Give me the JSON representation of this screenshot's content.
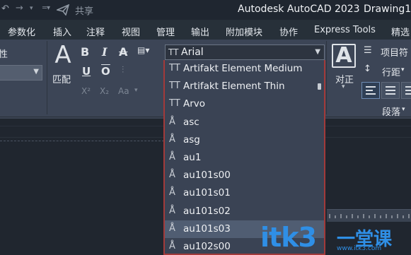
{
  "titlebar": {
    "share_label": "共享",
    "app_title": "Autodesk AutoCAD 2023",
    "doc_title": "Drawing1."
  },
  "menu": {
    "items": [
      "参数化",
      "插入",
      "注释",
      "视图",
      "管理",
      "输出",
      "附加模块",
      "协作",
      "Express Tools",
      "精选"
    ]
  },
  "ribbon": {
    "properties_label": "性",
    "match_label": "匹配",
    "align_label": "对正",
    "list_label": "项目符",
    "spacing_label": "行距",
    "paragraph_label": "段落",
    "tools": {
      "bold": "B",
      "italic": "I",
      "strike": "A",
      "underline": "U",
      "overline": "O",
      "superscript": "X²",
      "subscript": "X₂",
      "case": "Aa"
    }
  },
  "font_combo": {
    "value": "Arial"
  },
  "font_list": [
    {
      "name": "Artifakt Element Medium",
      "type": "truetype",
      "selected": false
    },
    {
      "name": "Artifakt Element Thin",
      "type": "truetype",
      "selected": false
    },
    {
      "name": "Arvo",
      "type": "truetype",
      "selected": false
    },
    {
      "name": "asc",
      "type": "shx",
      "selected": false
    },
    {
      "name": "asg",
      "type": "shx",
      "selected": false
    },
    {
      "name": "au1",
      "type": "shx",
      "selected": false
    },
    {
      "name": "au101s00",
      "type": "shx",
      "selected": false
    },
    {
      "name": "au101s01",
      "type": "shx",
      "selected": false
    },
    {
      "name": "au101s02",
      "type": "shx",
      "selected": false
    },
    {
      "name": "au101s03",
      "type": "shx",
      "selected": true
    },
    {
      "name": "au102s00",
      "type": "shx",
      "selected": false
    }
  ],
  "watermark": {
    "brand": "itk3",
    "cn": "一堂课",
    "url": "www.itk3.com"
  },
  "colors": {
    "accent_border": "#a23a3a",
    "watermark": "#2f8fe6",
    "selected_row": "#505d72"
  }
}
